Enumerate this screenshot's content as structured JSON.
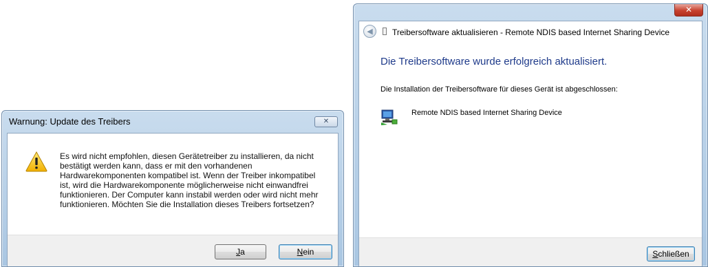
{
  "warning_dialog": {
    "title": "Warnung: Update des Treibers",
    "close_glyph": "✕",
    "icon": "warning-icon",
    "message": "Es wird nicht empfohlen, diesen Gerätetreiber zu installieren, da nicht\nbestätigt werden kann, dass er mit den vorhandenen\nHardwarekomponenten kompatibel ist.  Wenn der Treiber inkompatibel\nist, wird die Hardwarekomponente möglicherweise nicht einwandfrei\nfunktionieren. Der Computer kann instabil werden oder wird nicht mehr\nfunktionieren.  Möchten Sie die Installation dieses Treibers fortsetzen?",
    "buttons": {
      "yes_accel": "J",
      "yes_rest": "a",
      "no_accel": "N",
      "no_rest": "ein"
    }
  },
  "update_wizard": {
    "close_glyph": "✕",
    "back_glyph": "◀",
    "nav_title": "Treibersoftware aktualisieren - Remote NDIS based Internet Sharing Device",
    "heading": "Die Treibersoftware wurde erfolgreich aktualisiert.",
    "subtext": "Die Installation der Treibersoftware für dieses Gerät ist abgeschlossen:",
    "device_name": "Remote NDIS based Internet Sharing Device",
    "device_icon": "network-adapter-icon",
    "close_button_accel": "S",
    "close_button_rest": "chließen"
  },
  "colors": {
    "heading_blue": "#1e3a8a",
    "titlebar_blue": "#b6cfe8",
    "close_red": "#c7422f"
  }
}
